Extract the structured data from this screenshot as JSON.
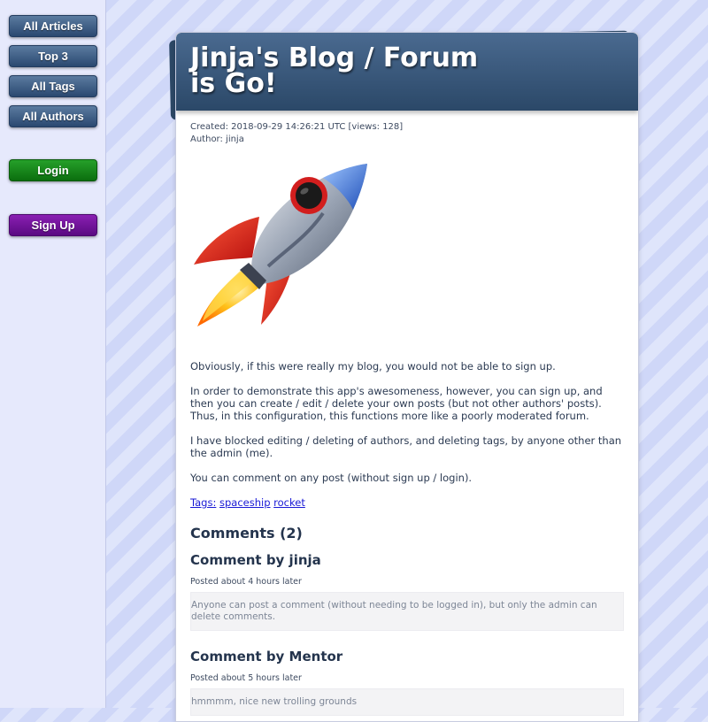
{
  "nav": {
    "all_articles": "All Articles",
    "top3": "Top 3",
    "all_tags": "All Tags",
    "all_authors": "All Authors",
    "login": "Login",
    "signup": "Sign Up"
  },
  "article": {
    "title": "Jinja's Blog / Forum is Go!",
    "created": "Created: 2018-09-29 14:26:21 UTC [views: 128]",
    "author": "Author: jinja",
    "image_icon": "rocket-icon",
    "paragraphs": [
      "Obviously, if this were really my blog, you would not be able to sign up.",
      "In order to demonstrate this app's awesomeness, however, you can sign up, and then you can create / edit / delete your own posts (but not other authors' posts). Thus, in this configuration, this functions more like a poorly moderated forum.",
      "I have blocked editing / deleting of authors, and deleting tags, by anyone other than the admin (me).",
      "You can comment on any post (without sign up / login)."
    ],
    "tags_label": "Tags:",
    "tags": [
      "spaceship",
      "rocket"
    ]
  },
  "comments": {
    "heading": "Comments (2)",
    "items": [
      {
        "title": "Comment by jinja",
        "posted": "Posted about 4 hours later",
        "body": "Anyone can post a comment (without needing to be logged in), but only the admin can delete comments."
      },
      {
        "title": "Comment by Mentor",
        "posted": "Posted about 5 hours later",
        "body": "hmmmm, nice new trolling grounds"
      }
    ]
  },
  "colors": {
    "nav_blue": "#2a4870",
    "nav_green": "#0b6e0e",
    "nav_purple": "#5a0a82",
    "header_bg": "#2b4868",
    "link": "#1a1ad6"
  }
}
